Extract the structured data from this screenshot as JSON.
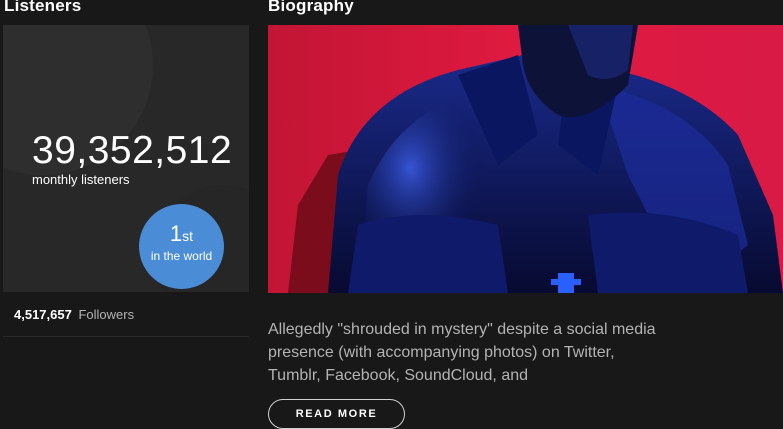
{
  "listeners": {
    "title": "Listeners",
    "monthly_count": "39,352,512",
    "monthly_label": "monthly listeners",
    "rank": {
      "number": "1",
      "suffix": "st",
      "label": "in the world"
    },
    "followers_count": "4,517,657",
    "followers_label": "Followers"
  },
  "biography": {
    "title": "Biography",
    "image": "artist-portrait",
    "text": "Allegedly \"shrouded in mystery\" despite a social media presence (with accompanying photos) on Twitter, Tumblr, Facebook, SoundCloud, and",
    "read_more_label": "READ MORE"
  },
  "colors": {
    "background": "#181818",
    "card": "#282828",
    "rank_badge": "#4a8cd6",
    "secondary_text": "#b3b3b3"
  }
}
